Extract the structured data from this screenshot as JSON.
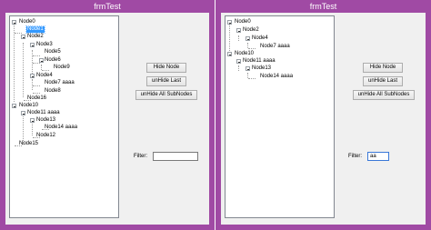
{
  "left": {
    "title": "frmTest",
    "nodes": {
      "n0": "Node0",
      "n1": "Node1",
      "n2": "Node2",
      "n3": "Node3",
      "n5": "Node5",
      "n6": "Node6",
      "n9": "Node9",
      "n4": "Node4",
      "n7": "Node7 aaaa",
      "n8": "Node8",
      "n16": "Node16",
      "n10": "Node10",
      "n11": "Node11 aaaa",
      "n13": "Node13",
      "n14": "Node14 aaaa",
      "n12": "Node12",
      "n15": "Node15"
    },
    "buttons": {
      "hide": "Hide Node",
      "unhide": "unHide Last",
      "unhide_all": "unHide All SubNodes"
    },
    "filter_label": "Filter:",
    "filter_value": ""
  },
  "right": {
    "title": "frmTest",
    "nodes": {
      "n0": "Node0",
      "n2": "Node2",
      "n4": "Node4",
      "n7": "Node7 aaaa",
      "n10": "Node10",
      "n11": "Node11 aaaa",
      "n13": "Node13",
      "n14": "Node14 aaaa"
    },
    "buttons": {
      "hide": "Hide Node",
      "unhide": "unHide Last",
      "unhide_all": "unHide All SubNodes"
    },
    "filter_label": "Filter:",
    "filter_value": "aa"
  },
  "colors": {
    "title_bar": "#a04aa4",
    "selection": "#3399ff"
  }
}
